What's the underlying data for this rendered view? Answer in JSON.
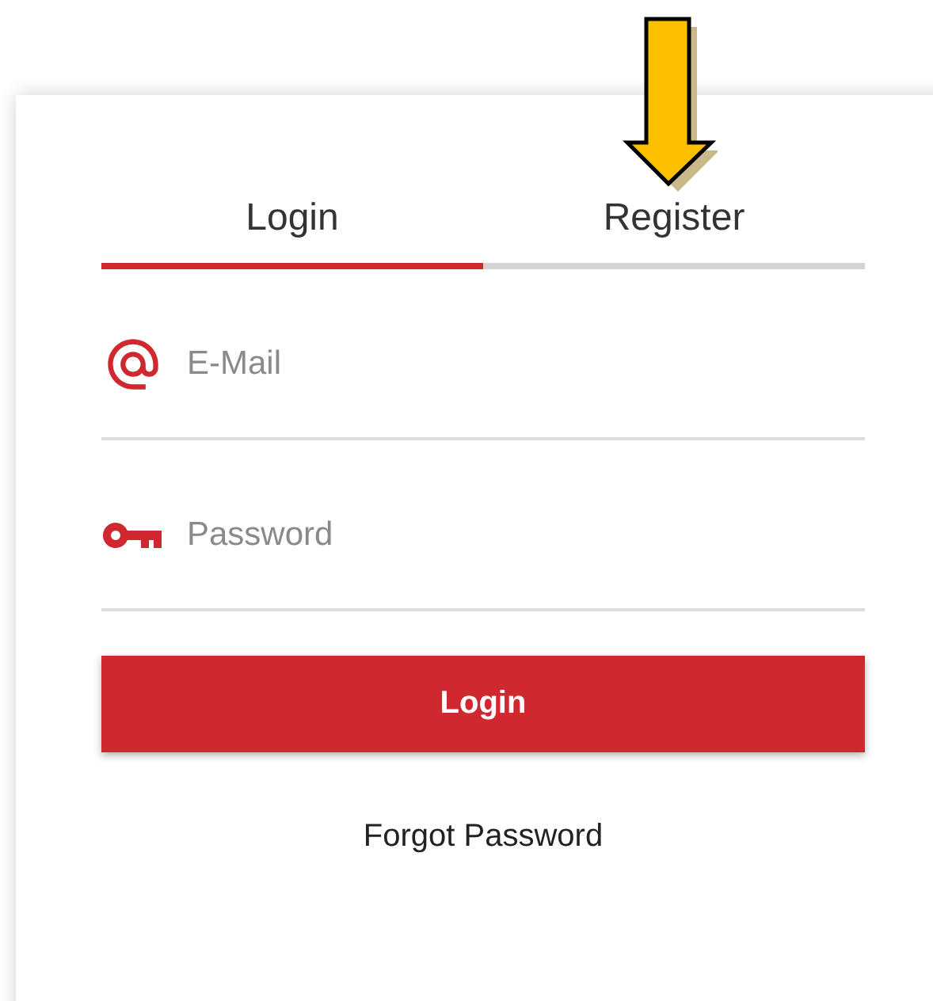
{
  "tabs": [
    {
      "label": "Login",
      "selected": true
    },
    {
      "label": "Register",
      "selected": false
    }
  ],
  "fields": [
    {
      "kind": "email",
      "placeholder": "E-Mail"
    },
    {
      "kind": "password",
      "placeholder": "Password"
    }
  ],
  "submit_button": "Login",
  "forgot_link": "Forgot Password"
}
